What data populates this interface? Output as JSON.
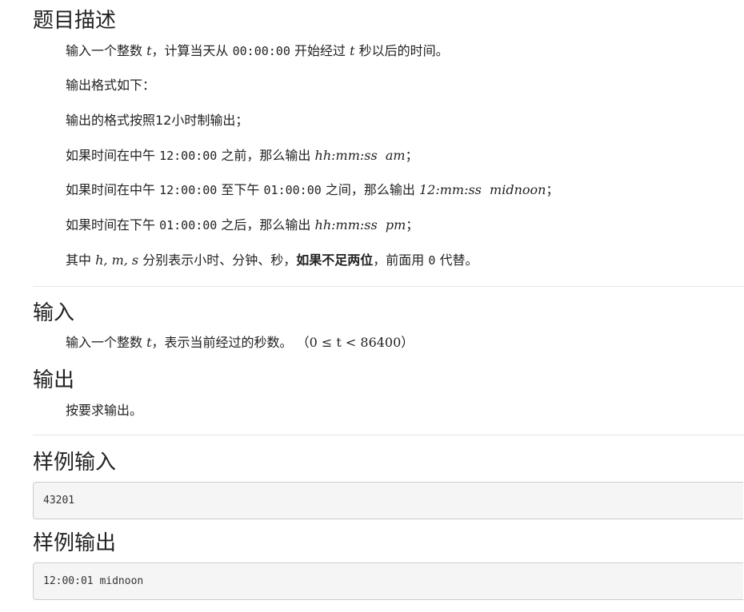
{
  "description": {
    "title": "题目描述",
    "line1": {
      "a": "输入一个整数 ",
      "t": "t",
      "b": "，计算当天从 ",
      "time": "00:00:00",
      "c": " 开始经过 ",
      "t2": "t",
      "d": " 秒以后的时间。"
    },
    "line2": "输出格式如下：",
    "line3": "输出的格式按照12小时制输出；",
    "line4": {
      "a": "如果时间在中午 ",
      "time": "12:00:00",
      "b": " 之前，那么输出 ",
      "fmt": "hh:mm:ss  am",
      "c": "；"
    },
    "line5": {
      "a": "如果时间在中午 ",
      "time": "12:00:00",
      "b": " 至下午 ",
      "time2": "01:00:00",
      "c": " 之间，那么输出 ",
      "fmt": "12:mm:ss  midnoon",
      "d": "；"
    },
    "line6": {
      "a": "如果时间在下午 ",
      "time": "01:00:00",
      "b": " 之后，那么输出 ",
      "fmt": "hh:mm:ss  pm",
      "c": "；"
    },
    "line7": {
      "a": "其中 ",
      "vars": "h, m, s",
      "b": " 分别表示小时、分钟、秒，",
      "bold": "如果不足两位",
      "c": "，前面用 ",
      "zero": "0",
      "d": " 代替。"
    }
  },
  "input": {
    "title": "输入",
    "line": {
      "a": "输入一个整数 ",
      "t": "t",
      "b": "，表示当前经过的秒数。 （",
      "range": "0 ≤ t < 86400",
      "c": "）"
    }
  },
  "output": {
    "title": "输出",
    "line": "按要求输出。"
  },
  "sample_input": {
    "title": "样例输入",
    "code": "43201"
  },
  "sample_output": {
    "title": "样例输出",
    "code": "12:00:01 midnoon"
  }
}
